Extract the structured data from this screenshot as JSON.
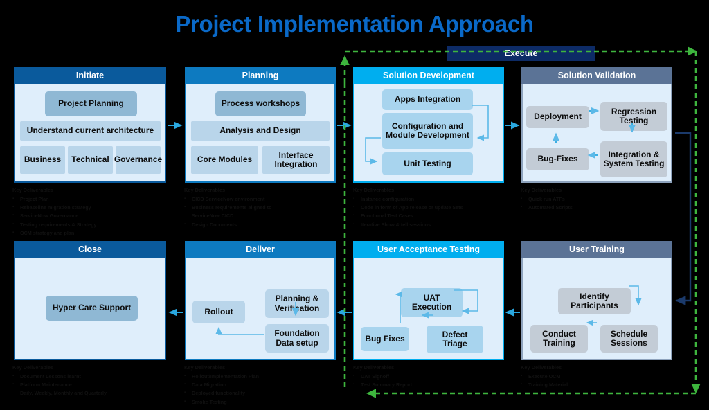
{
  "page": {
    "title": "Project Implementation Approach",
    "title_color": "#0a69c8",
    "background": "#000000"
  },
  "execute_banner": {
    "label": "Execute",
    "color": "#0d2b66"
  },
  "key_deliverables_heading": "Key Deliverables",
  "phases": [
    {
      "id": "initiate",
      "title": "Initiate",
      "header_color": "#0a5a9c",
      "nodes": [
        {
          "label": "Project Planning",
          "style": "steel"
        },
        {
          "label": "Understand current architecture",
          "style": "pale"
        },
        {
          "label": "Business",
          "style": "pale"
        },
        {
          "label": "Technical",
          "style": "pale"
        },
        {
          "label": "Governance",
          "style": "pale"
        }
      ],
      "deliverables": [
        "Project Plan",
        "Rebaseline migration strategy",
        "ServiceNow Governance",
        "Testing requirements & Strategy",
        "OCM strategy and plan"
      ]
    },
    {
      "id": "planning",
      "title": "Planning",
      "header_color": "#0d7ac0",
      "nodes": [
        {
          "label": "Process workshops",
          "style": "steel"
        },
        {
          "label": "Analysis and Design",
          "style": "pale"
        },
        {
          "label": "Core Modules",
          "style": "pale"
        },
        {
          "label": "Interface Integration",
          "style": "pale"
        }
      ],
      "deliverables": [
        "CICD ServiceNow environment",
        "Business requirements aligned to",
        "ServiceNow CICD",
        "Design Documents"
      ]
    },
    {
      "id": "solution-development",
      "title": "Solution Development",
      "header_color": "#00aeef",
      "nodes": [
        {
          "label": "Apps Integration",
          "style": "lite"
        },
        {
          "label": "Configuration and Module Development",
          "style": "lite"
        },
        {
          "label": "Unit Testing",
          "style": "lite"
        }
      ],
      "deliverables": [
        "Instance configuration",
        "Code in form of App release or update Sets",
        "Functional Test Cases",
        "Iterative Show & tell sessions"
      ]
    },
    {
      "id": "solution-validation",
      "title": "Solution Validation",
      "header_color": "#5b7396",
      "nodes": [
        {
          "label": "Deployment",
          "style": "gray"
        },
        {
          "label": "Regression Testing",
          "style": "gray"
        },
        {
          "label": "Bug-Fixes",
          "style": "gray"
        },
        {
          "label": "Integration & System Testing",
          "style": "gray"
        }
      ],
      "deliverables": [
        "Quick run ATFs",
        "Automated Scripts"
      ]
    },
    {
      "id": "close",
      "title": "Close",
      "header_color": "#0a5a9c",
      "nodes": [
        {
          "label": "Hyper Care Support",
          "style": "steel"
        }
      ],
      "deliverables": [
        "Document Lessons learnt",
        "Platform Maintenance",
        "Daily, Weekly, Monthly and Quarterly"
      ]
    },
    {
      "id": "deliver",
      "title": "Deliver",
      "header_color": "#0d7ac0",
      "nodes": [
        {
          "label": "Rollout",
          "style": "pale"
        },
        {
          "label": "Planning & Verification",
          "style": "pale"
        },
        {
          "label": "Foundation Data setup",
          "style": "pale"
        }
      ],
      "deliverables": [
        "Rollout/Implementation Plan",
        "Data Migration",
        "Deployed functionality",
        "Smoke Testing"
      ]
    },
    {
      "id": "user-acceptance-testing",
      "title": "User Acceptance Testing",
      "header_color": "#00aeef",
      "nodes": [
        {
          "label": "UAT Execution",
          "style": "lite"
        },
        {
          "label": "Bug Fixes",
          "style": "lite"
        },
        {
          "label": "Defect Triage",
          "style": "lite"
        }
      ],
      "deliverables": [
        "UAT Signoff",
        "Test Summary Report"
      ]
    },
    {
      "id": "user-training",
      "title": "User Training",
      "header_color": "#5b7396",
      "nodes": [
        {
          "label": "Identify Participants",
          "style": "gray"
        },
        {
          "label": "Conduct Training",
          "style": "gray"
        },
        {
          "label": "Schedule Sessions",
          "style": "gray"
        }
      ],
      "deliverables": [
        "Execute OCM",
        "Training Material"
      ]
    }
  ],
  "connector_colors": {
    "flow_arrow": "#2aa8e0",
    "feedback_loop": "#3eb53e",
    "return_path": "#1b3a6b"
  }
}
